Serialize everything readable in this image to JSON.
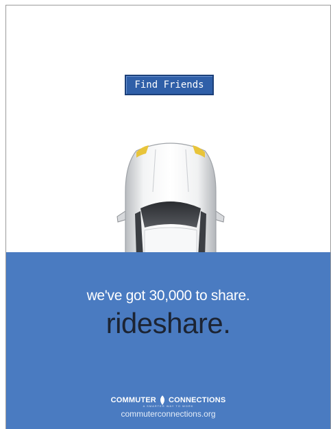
{
  "button": {
    "label": "Find Friends"
  },
  "banner": {
    "tagline": "we've got 30,000 to share.",
    "headline": "rideshare.",
    "logo_left": "COMMUTER",
    "logo_right": "CONNECTIONS",
    "logo_tagline": "A SMARTER WAY TO WORK",
    "url": "commuterconnections.org"
  },
  "colors": {
    "banner_bg": "#4a7bc1",
    "button_bg": "#2f5fa8",
    "headline": "#1c2433"
  },
  "icons": {
    "car": "car-top-view-icon",
    "logo_mark": "leaf-icon"
  }
}
